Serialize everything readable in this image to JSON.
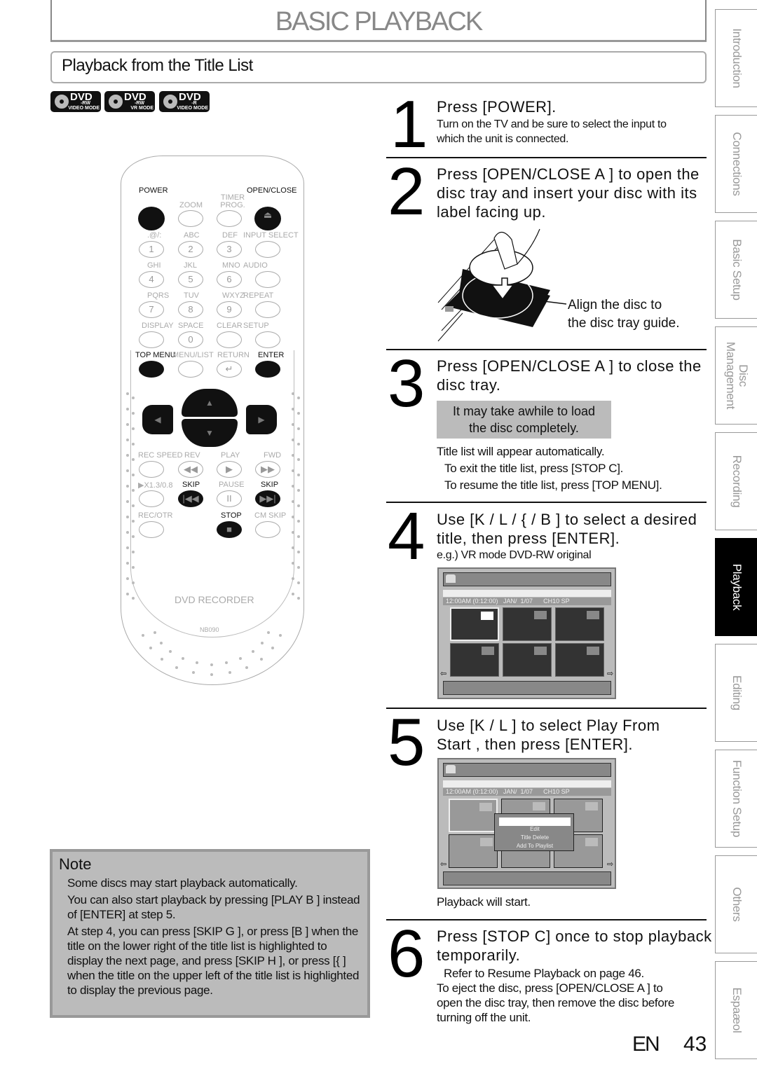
{
  "header": {
    "page_title": "BASIC PLAYBACK",
    "section_title": "Playback from the Title List"
  },
  "disc_badges": [
    {
      "icon": "dvd-rw-video-mode-icon",
      "label": "DVD",
      "type": "-RW",
      "mode": "VIDEO MODE"
    },
    {
      "icon": "dvd-rw-vr-mode-icon",
      "label": "DVD",
      "type": "-RW",
      "mode": "VR MODE"
    },
    {
      "icon": "dvd-r-video-mode-icon",
      "label": "DVD",
      "type": "-R",
      "mode": "VIDEO MODE"
    }
  ],
  "remote": {
    "labels": {
      "power": "POWER",
      "open_close": "OPEN/CLOSE",
      "zoom": "ZOOM",
      "timer_prog": "TIMER PROG.",
      "sym": ".@/:",
      "abc": "ABC",
      "def": "DEF",
      "input_select": "INPUT SELECT",
      "ghi": "GHI",
      "jkl": "JKL",
      "mno": "MNO",
      "audio": "AUDIO",
      "pqrs": "PQRS",
      "tuv": "TUV",
      "wxyz": "WXYZ",
      "repeat": "REPEAT",
      "display": "DISPLAY",
      "space": "SPACE",
      "clear": "CLEAR",
      "setup": "SETUP",
      "top_menu": "TOP MENU",
      "menu_list": "MENU/LIST",
      "return": "RETURN",
      "enter": "ENTER",
      "rec_speed": "REC SPEED",
      "rev": "REV",
      "play": "PLAY",
      "fwd": "FWD",
      "x13": "▶X1.3/0.8",
      "skip_back": "SKIP",
      "pause": "PAUSE",
      "skip_fwd": "SKIP",
      "rec_otr": "REC/OTR",
      "stop": "STOP",
      "cm_skip": "CM SKIP",
      "brand": "DVD RECORDER",
      "model": "NB090"
    },
    "digits": [
      "1",
      "2",
      "3",
      "4",
      "5",
      "6",
      "7",
      "8",
      "9",
      "0"
    ],
    "glyphs": {
      "eject": "⏏",
      "up": "▲",
      "down": "▼",
      "left": "◀",
      "right": "▶",
      "rev": "◀◀",
      "play": "▶",
      "fwd": "▶▶",
      "skip_back": "|◀◀",
      "pause": "II",
      "skip_fwd": "▶▶|",
      "stop": "■",
      "return": "↵"
    }
  },
  "steps": [
    {
      "number": "1",
      "heading": "Press [POWER].",
      "text": [
        "Turn on the TV and be sure to select the input to",
        "which the unit is connected."
      ]
    },
    {
      "number": "2",
      "heading": [
        "Press [OPEN/CLOSE A ] to open the",
        "disc tray and insert your disc with its",
        "label facing up."
      ],
      "callout": [
        "Align the disc to",
        "the disc tray guide."
      ]
    },
    {
      "number": "3",
      "heading": [
        "Press [OPEN/CLOSE A ] to close the",
        "disc tray."
      ],
      "infobox": [
        "It may take awhile to load",
        "the disc completely."
      ],
      "text": [
        "Title list will appear automatically.",
        "To exit the title list, press [STOP C].",
        "To resume the title list, press [TOP MENU]."
      ]
    },
    {
      "number": "4",
      "heading": [
        "Use [K / L / {  / B ] to select a desired",
        "title, then press [ENTER]."
      ],
      "caption": "e.g.) VR mode DVD-RW original"
    },
    {
      "number": "5",
      "heading": [
        "Use [K / L ] to select  Play From",
        "Start , then press [ENTER]."
      ],
      "text": [
        "Playback will start."
      ]
    },
    {
      "number": "6",
      "heading": [
        "Press [STOP C] once to stop playback",
        "temporarily."
      ],
      "text": [
        "Refer to  Resume Playback  on page 46.",
        "To eject the disc, press [OPEN/CLOSE A ] to",
        "open the disc tray, then remove the disc before",
        "turning off the unit."
      ]
    }
  ],
  "title_list_screen": {
    "info": "12:00AM (0:12:00)   JAN/  1/07      CH10 SP",
    "nav_left": "⇦",
    "nav_right": "⇨",
    "popup_items": [
      "",
      "Edit",
      "Title Delete",
      "Add To Playlist"
    ]
  },
  "note": {
    "title": "Note",
    "items": [
      "Some discs may start playback automatically.",
      "You can also start playback by pressing [PLAY B ] instead of [ENTER] at step 5.",
      "At step 4, you can press [SKIP G  ], or press [B ] when the title on the lower right of the title list is highlighted to display the next page, and press [SKIP H  ], or press [{  ] when the title on the upper left of the title list is highlighted to display the previous page."
    ]
  },
  "side_tabs": [
    {
      "label": "Introduction",
      "active": false
    },
    {
      "label": "Connections",
      "active": false
    },
    {
      "label": "Basic Setup",
      "active": false
    },
    {
      "label": "Disc\nManagement",
      "active": false
    },
    {
      "label": "Recording",
      "active": false
    },
    {
      "label": "Playback",
      "active": true
    },
    {
      "label": "Editing",
      "active": false
    },
    {
      "label": "Function Setup",
      "active": false
    },
    {
      "label": "Others",
      "active": false
    },
    {
      "label": "Espaæol",
      "active": false
    }
  ],
  "footer": {
    "lang": "EN",
    "page": "43"
  }
}
